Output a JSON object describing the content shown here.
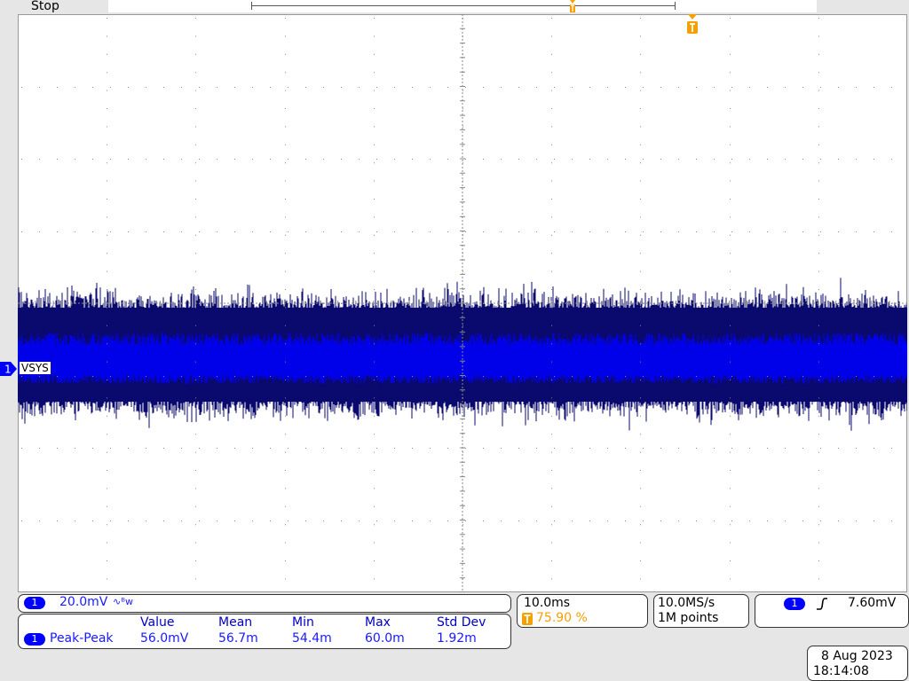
{
  "top": {
    "status": "Stop"
  },
  "channel": {
    "number": "1",
    "label": "VSYS",
    "scale": "20.0mV",
    "coupling_icon": "∿ᴮw",
    "color": "#0000ff",
    "trace_dark": "#0a0a6e"
  },
  "timebase": {
    "scale": "10.0ms",
    "trigger_position": "75.90 %",
    "trigger_color": "#f5a000"
  },
  "acquisition": {
    "rate": "10.0MS/s",
    "points": "1M points"
  },
  "trigger": {
    "source": "1",
    "slope_icon": "rising-edge-icon",
    "level": "7.60mV"
  },
  "measurements": {
    "headers": [
      "Value",
      "Mean",
      "Min",
      "Max",
      "Std Dev"
    ],
    "rows": [
      {
        "source": "1",
        "name": "Peak-Peak",
        "values": [
          "56.0mV",
          "56.7m",
          "54.4m",
          "60.0m",
          "1.92m"
        ]
      }
    ]
  },
  "datetime": {
    "date": "8 Aug 2023",
    "time": "18:14:08"
  }
}
